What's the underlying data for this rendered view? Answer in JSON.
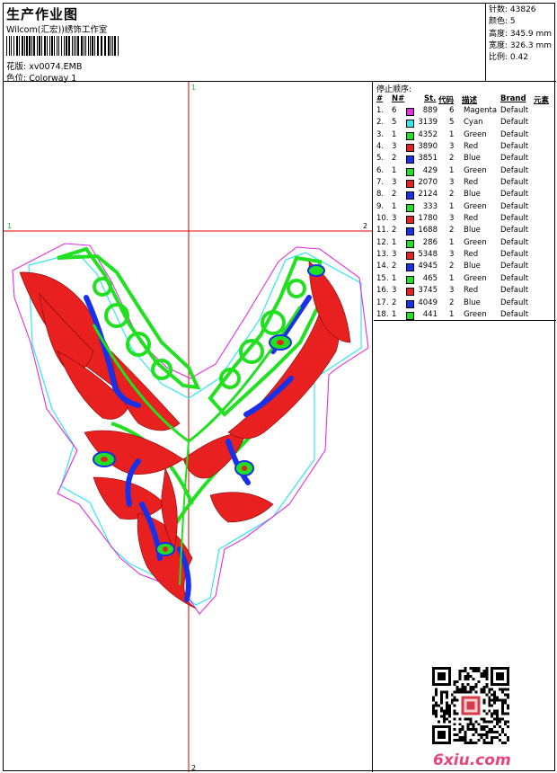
{
  "header": {
    "title": "生产作业图",
    "company": "Wilcom(汇宏))绣饰工作室",
    "design_label": "花版:",
    "design_value": "xv0074.EMB",
    "colorway_label": "色位:",
    "colorway_value": "Colorway 1"
  },
  "stats": {
    "stitches": "针数: 43826",
    "colors": "颜色: 5",
    "height": "高度: 345.9 mm",
    "width": "宽度: 326.3 mm",
    "scale": "比例: 0.42"
  },
  "canvas": {
    "marker_top": "1",
    "marker_left": "1",
    "marker_right": "2",
    "marker_bottom": "2"
  },
  "stop_sequence": {
    "title": "停止顺序:",
    "columns": [
      "#",
      "N#",
      "St.",
      "代码",
      "描述",
      "Brand",
      "元素"
    ],
    "rows": [
      {
        "idx": "1.",
        "need": "6",
        "color": "#e030e0",
        "st": "889",
        "code": "6",
        "desc": "Magenta",
        "brand": "Default"
      },
      {
        "idx": "2.",
        "need": "5",
        "color": "#30e8f0",
        "st": "3139",
        "code": "5",
        "desc": "Cyan",
        "brand": "Default"
      },
      {
        "idx": "3.",
        "need": "1",
        "color": "#20e020",
        "st": "4352",
        "code": "1",
        "desc": "Green",
        "brand": "Default"
      },
      {
        "idx": "4.",
        "need": "3",
        "color": "#e82020",
        "st": "3890",
        "code": "3",
        "desc": "Red",
        "brand": "Default"
      },
      {
        "idx": "5.",
        "need": "2",
        "color": "#1830e8",
        "st": "3851",
        "code": "2",
        "desc": "Blue",
        "brand": "Default"
      },
      {
        "idx": "6.",
        "need": "1",
        "color": "#20e020",
        "st": "429",
        "code": "1",
        "desc": "Green",
        "brand": "Default"
      },
      {
        "idx": "7.",
        "need": "3",
        "color": "#e82020",
        "st": "2070",
        "code": "3",
        "desc": "Red",
        "brand": "Default"
      },
      {
        "idx": "8.",
        "need": "2",
        "color": "#1830e8",
        "st": "2124",
        "code": "2",
        "desc": "Blue",
        "brand": "Default"
      },
      {
        "idx": "9.",
        "need": "1",
        "color": "#20e020",
        "st": "333",
        "code": "1",
        "desc": "Green",
        "brand": "Default"
      },
      {
        "idx": "10.",
        "need": "3",
        "color": "#e82020",
        "st": "1780",
        "code": "3",
        "desc": "Red",
        "brand": "Default"
      },
      {
        "idx": "11.",
        "need": "2",
        "color": "#1830e8",
        "st": "1688",
        "code": "2",
        "desc": "Blue",
        "brand": "Default"
      },
      {
        "idx": "12.",
        "need": "1",
        "color": "#20e020",
        "st": "286",
        "code": "1",
        "desc": "Green",
        "brand": "Default"
      },
      {
        "idx": "13.",
        "need": "3",
        "color": "#e82020",
        "st": "5348",
        "code": "3",
        "desc": "Red",
        "brand": "Default"
      },
      {
        "idx": "14.",
        "need": "2",
        "color": "#1830e8",
        "st": "4945",
        "code": "2",
        "desc": "Blue",
        "brand": "Default"
      },
      {
        "idx": "15.",
        "need": "1",
        "color": "#20e020",
        "st": "465",
        "code": "1",
        "desc": "Green",
        "brand": "Default"
      },
      {
        "idx": "16.",
        "need": "3",
        "color": "#e82020",
        "st": "3745",
        "code": "3",
        "desc": "Red",
        "brand": "Default"
      },
      {
        "idx": "17.",
        "need": "2",
        "color": "#1830e8",
        "st": "4049",
        "code": "2",
        "desc": "Blue",
        "brand": "Default"
      },
      {
        "idx": "18.",
        "need": "1",
        "color": "#20e020",
        "st": "441",
        "code": "1",
        "desc": "Green",
        "brand": "Default"
      }
    ]
  },
  "watermark": {
    "site": "6xiu.com"
  },
  "colors": {
    "red": "#e82020",
    "green": "#20e020",
    "blue": "#1830e8",
    "magenta": "#e030e0",
    "cyan": "#30e8f0",
    "guide": "#e00000",
    "logo": "#e8457a"
  }
}
